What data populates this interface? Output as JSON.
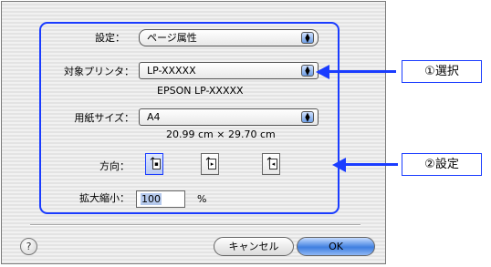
{
  "dialog": {
    "settings_label": "設定：",
    "settings_value": "ページ属性",
    "printer_label": "対象プリンタ：",
    "printer_value": "LP-XXXXX",
    "printer_desc": "EPSON LP-XXXXX",
    "paper_label": "用紙サイズ：",
    "paper_value": "A4",
    "paper_dims": "20.99 cm × 29.70 cm",
    "orientation_label": "方向：",
    "orientation_selected": "portrait",
    "scale_label": "拡大縮小：",
    "scale_value": "100",
    "scale_unit": "%",
    "help_symbol": "?",
    "cancel_label": "キャンセル",
    "ok_label": "OK"
  },
  "annotations": {
    "select_callout": "①選択",
    "set_callout": "②設定"
  },
  "colors": {
    "accent": "#1a3cff",
    "ok_button": "#3f7fe0"
  }
}
